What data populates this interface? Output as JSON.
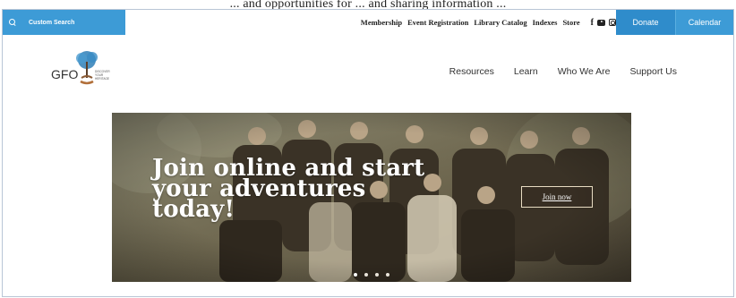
{
  "caption": "... and opportunities for ... and sharing information ...",
  "search": {
    "label": "Custom Search",
    "icon": "search-icon"
  },
  "utility_nav": {
    "items": [
      "Membership",
      "Event Registration",
      "Library Catalog",
      "Indexes",
      "Store"
    ]
  },
  "social": {
    "facebook": "f",
    "youtube": "youtube-icon",
    "instagram": "instagram-icon"
  },
  "buttons": {
    "donate": "Donate",
    "calendar": "Calendar"
  },
  "brand": {
    "logo_text": "GFO",
    "tagline": "DISCOVER YOUR HERITAGE"
  },
  "main_nav": {
    "items": [
      "Resources",
      "Learn",
      "Who We Are",
      "Support Us"
    ]
  },
  "hero": {
    "heading_line1": "Join online and start",
    "heading_line2": "your adventures",
    "heading_line3": "today!",
    "cta": "Join now",
    "slides": 4,
    "active_slide": 1
  },
  "colors": {
    "accent_blue": "#3d9bd6",
    "donate_blue": "#2f8ccb",
    "hero_tone": "#6e6651"
  }
}
